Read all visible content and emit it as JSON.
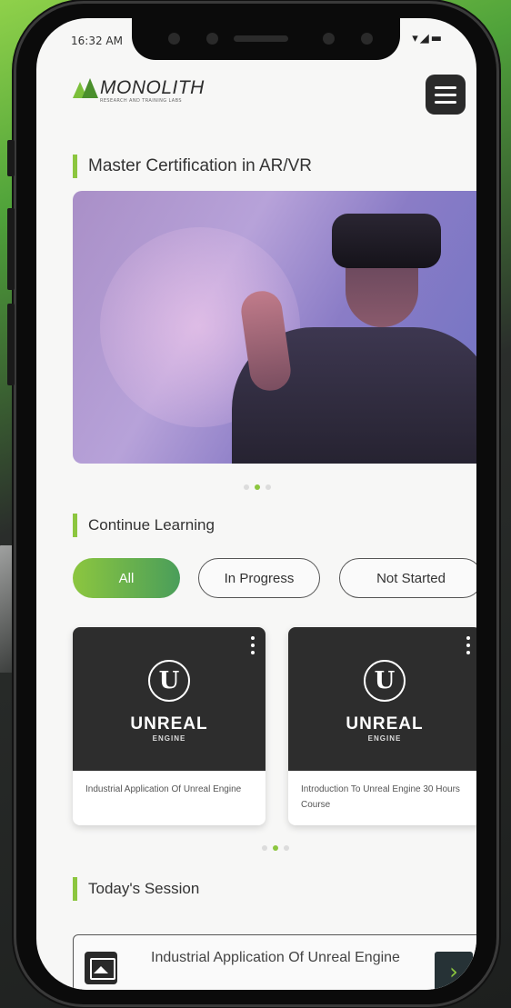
{
  "status_bar": {
    "time": "16:32 AM",
    "icons": "▾◢▬"
  },
  "logo": {
    "name": "MONOLITH",
    "sub": "RESEARCH AND TRAINING LABS"
  },
  "sections": {
    "certification": "Master Certification in AR/VR",
    "continue_learning": "Continue Learning",
    "todays_session": "Today's Session"
  },
  "filters": [
    {
      "label": "All",
      "active": true
    },
    {
      "label": "In Progress",
      "active": false
    },
    {
      "label": "Not Started",
      "active": false
    }
  ],
  "courses": [
    {
      "brand": "UNREAL",
      "brand_sub": "ENGINE",
      "logo_glyph": "U",
      "title": "Industrial Application Of Unreal Engine"
    },
    {
      "brand": "UNREAL",
      "brand_sub": "ENGINE",
      "logo_glyph": "U",
      "title": "Introduction To Unreal Engine 30 Hours Course"
    }
  ],
  "session": {
    "title": "Industrial Application Of Unreal Engine",
    "go_icon": "›"
  },
  "carousel": {
    "hero_active": 2,
    "courses_active": 2
  },
  "colors": {
    "accent": "#8cc63f",
    "dark": "#2a2a2a"
  }
}
